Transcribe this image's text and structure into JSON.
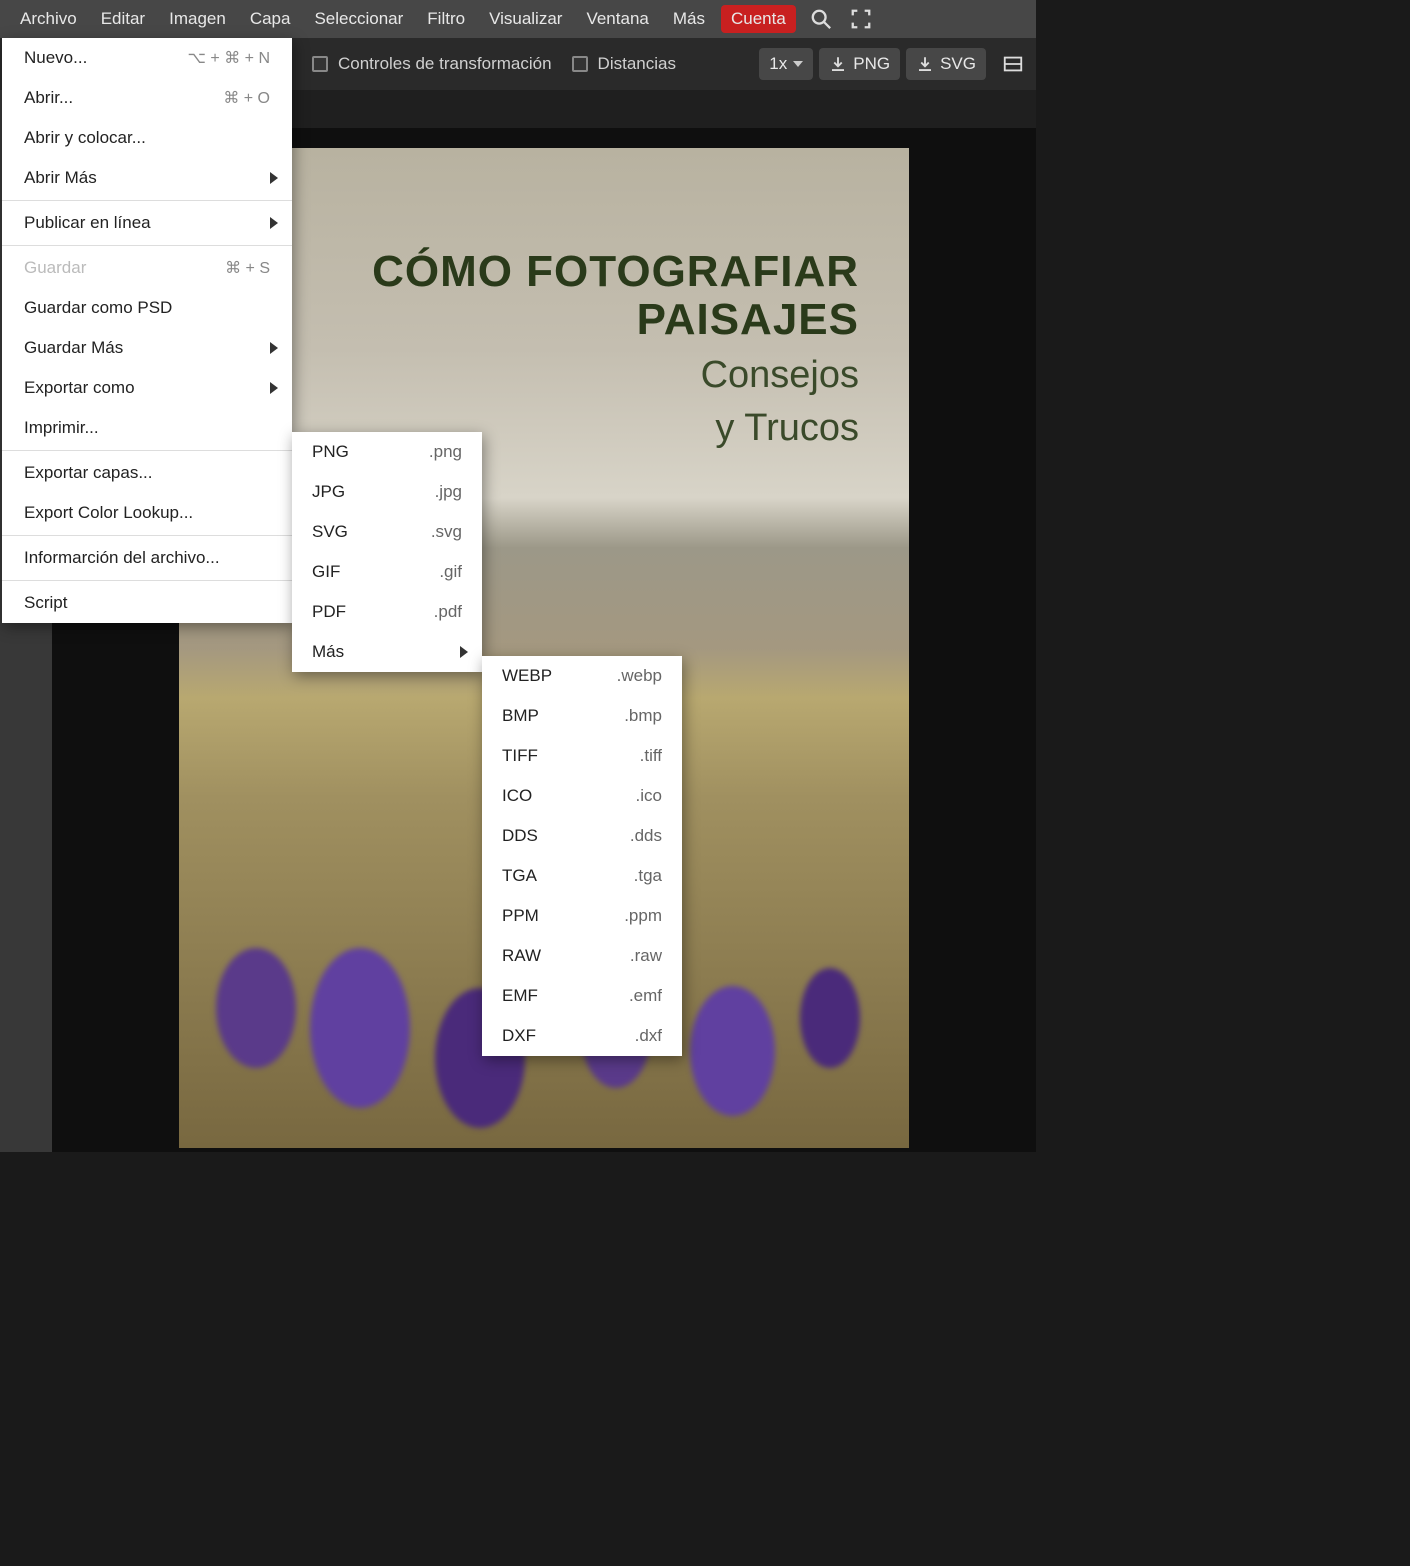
{
  "menubar": {
    "items": [
      "Archivo",
      "Editar",
      "Imagen",
      "Capa",
      "Seleccionar",
      "Filtro",
      "Visualizar",
      "Ventana",
      "Más"
    ],
    "account": "Cuenta"
  },
  "toolbar": {
    "transform_controls": "Controles de transformación",
    "distances": "Distancias",
    "zoom": "1x",
    "export_png": "PNG",
    "export_svg": "SVG"
  },
  "canvas": {
    "title_line1": "CÓMO FOTOGRAFIAR",
    "title_line2": "PAISAJES",
    "subtitle_line1": "Consejos",
    "subtitle_line2": "y Trucos"
  },
  "archivo_menu": [
    {
      "label": "Nuevo...",
      "shortcut": "⌥ + ⌘ + N",
      "type": "item"
    },
    {
      "label": "Abrir...",
      "shortcut": "⌘ + O",
      "type": "item"
    },
    {
      "label": "Abrir y colocar...",
      "type": "item"
    },
    {
      "label": "Abrir Más",
      "type": "submenu"
    },
    {
      "type": "sep"
    },
    {
      "label": "Publicar en línea",
      "type": "submenu"
    },
    {
      "type": "sep"
    },
    {
      "label": "Guardar",
      "shortcut": "⌘ + S",
      "type": "item",
      "disabled": true
    },
    {
      "label": "Guardar como PSD",
      "type": "item"
    },
    {
      "label": "Guardar Más",
      "type": "submenu"
    },
    {
      "label": "Exportar como",
      "type": "submenu"
    },
    {
      "label": "Imprimir...",
      "type": "item"
    },
    {
      "type": "sep"
    },
    {
      "label": "Exportar capas...",
      "type": "item"
    },
    {
      "label": "Export Color Lookup...",
      "type": "item"
    },
    {
      "type": "sep"
    },
    {
      "label": "Informarción del archivo...",
      "type": "item"
    },
    {
      "type": "sep"
    },
    {
      "label": "Script",
      "type": "item"
    }
  ],
  "export_submenu": [
    {
      "label": "PNG",
      "ext": ".png"
    },
    {
      "label": "JPG",
      "ext": ".jpg"
    },
    {
      "label": "SVG",
      "ext": ".svg"
    },
    {
      "label": "GIF",
      "ext": ".gif"
    },
    {
      "label": "PDF",
      "ext": ".pdf"
    },
    {
      "label": "Más",
      "ext": "",
      "submenu": true
    }
  ],
  "more_submenu": [
    {
      "label": "WEBP",
      "ext": ".webp"
    },
    {
      "label": "BMP",
      "ext": ".bmp"
    },
    {
      "label": "TIFF",
      "ext": ".tiff"
    },
    {
      "label": "ICO",
      "ext": ".ico"
    },
    {
      "label": "DDS",
      "ext": ".dds"
    },
    {
      "label": "TGA",
      "ext": ".tga"
    },
    {
      "label": "PPM",
      "ext": ".ppm"
    },
    {
      "label": "RAW",
      "ext": ".raw"
    },
    {
      "label": "EMF",
      "ext": ".emf"
    },
    {
      "label": "DXF",
      "ext": ".dxf"
    }
  ]
}
